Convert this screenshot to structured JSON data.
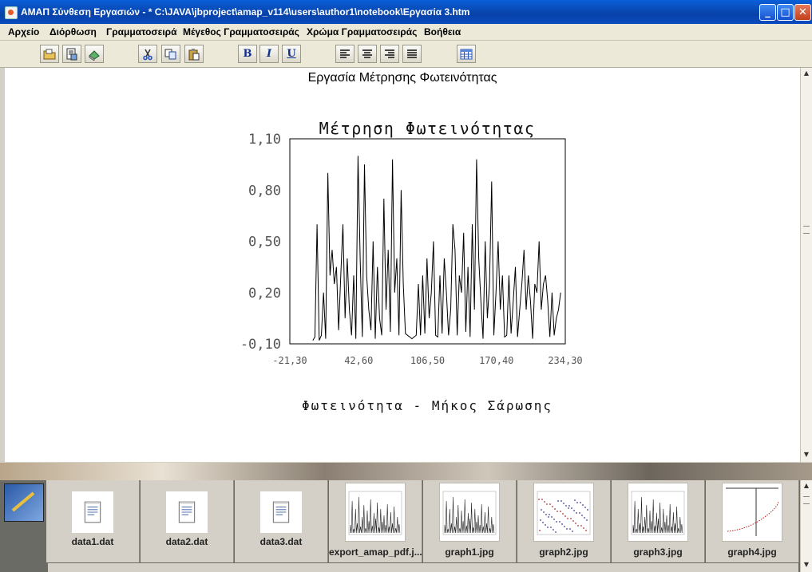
{
  "window": {
    "title": "ΑΜΑΠ Σύνθεση Εργασιών - * C:\\JAVA\\jbproject\\amap_v114\\users\\author1\\notebook\\Εργασία 3.htm",
    "minimize": "_",
    "maximize": "□",
    "close": "✕"
  },
  "menu": {
    "items": [
      "Αρχείο",
      "Διόρθωση",
      "Γραμματοσειρά",
      "Μέγεθος Γραμματοσειράς",
      "Χρώμα Γραμματοσειράς",
      "Βοήθεια"
    ]
  },
  "toolbar": {
    "bold": "B",
    "italic": "I",
    "underline": "U"
  },
  "document": {
    "heading": "Εργασία Μέτρησης Φωτεινότητας"
  },
  "chart_data": {
    "type": "line",
    "title": "Μέτρηση Φωτεινότητας",
    "xlabel": "Φωτεινότητα - Μήκος Σάρωσης",
    "ylabel": "",
    "xlim": [
      -21.3,
      234.3
    ],
    "ylim": [
      -0.1,
      1.1
    ],
    "x_ticks": [
      "-21,30",
      "42,60",
      "106,50",
      "170,40",
      "234,30"
    ],
    "y_ticks": [
      "-0,10",
      "0,20",
      "0,50",
      "0,80",
      "1,10"
    ],
    "grid": false,
    "legend": "none",
    "line_color": "#000000",
    "x": [
      0,
      2,
      4,
      6,
      8,
      10,
      12,
      14,
      16,
      18,
      20,
      22,
      24,
      26,
      28,
      30,
      32,
      34,
      36,
      38,
      40,
      42,
      44,
      46,
      48,
      50,
      52,
      54,
      56,
      58,
      60,
      62,
      64,
      66,
      68,
      70,
      72,
      74,
      76,
      78,
      80,
      82,
      84,
      86,
      88,
      90,
      92,
      94,
      96,
      98,
      100,
      102,
      104,
      106,
      108,
      110,
      112,
      114,
      116,
      118,
      120,
      122,
      124,
      126,
      128,
      130,
      132,
      134,
      136,
      138,
      140,
      142,
      144,
      146,
      148,
      150,
      152,
      154,
      156,
      158,
      160,
      162,
      164,
      166,
      168,
      170,
      172,
      174,
      176,
      178,
      180,
      182,
      184,
      186,
      188,
      190,
      192,
      194,
      196,
      198,
      200,
      202,
      204,
      206,
      208,
      210,
      212,
      214,
      216,
      218,
      220,
      222,
      224,
      226,
      228,
      230
    ],
    "values": [
      -0.08,
      -0.06,
      0.6,
      -0.08,
      -0.05,
      0.2,
      -0.07,
      0.9,
      0.3,
      0.45,
      0.25,
      0.35,
      -0.02,
      0.3,
      0.6,
      0.05,
      0.4,
      0.1,
      -0.05,
      0.3,
      -0.07,
      1.0,
      0.4,
      -0.06,
      0.95,
      0.3,
      0.1,
      -0.02,
      0.5,
      -0.07,
      0.35,
      0.05,
      -0.05,
      0.75,
      0.1,
      0.45,
      -0.03,
      0.98,
      0.2,
      0.4,
      -0.05,
      0.8,
      0.25,
      -0.04,
      -0.05,
      -0.06,
      -0.07,
      -0.06,
      -0.05,
      0.25,
      -0.05,
      0.3,
      -0.04,
      0.4,
      0.05,
      0.2,
      0.5,
      -0.05,
      -0.06,
      0.3,
      -0.04,
      0.4,
      0.2,
      -0.05,
      0.1,
      0.6,
      0.45,
      -0.05,
      0.3,
      0.2,
      0.55,
      -0.03,
      0.35,
      -0.06,
      0.6,
      0.1,
      0.98,
      0.4,
      0.15,
      -0.07,
      0.5,
      0.05,
      0.25,
      0.85,
      -0.05,
      0.2,
      0.5,
      0.1,
      0.3,
      -0.06,
      -0.05,
      0.3,
      -0.04,
      0.15,
      0.35,
      -0.06,
      0.1,
      0.25,
      0.45,
      0.1,
      0.3,
      0.15,
      -0.07,
      0.25,
      0.2,
      0.5,
      0.1,
      0.25,
      0.3,
      0.15,
      -0.06,
      0.2,
      -0.05,
      0.05,
      0.1,
      0.2
    ]
  },
  "thumbnails": [
    {
      "label": "data1.dat",
      "kind": "doc"
    },
    {
      "label": "data2.dat",
      "kind": "doc"
    },
    {
      "label": "data3.dat",
      "kind": "doc"
    },
    {
      "label": "export_amap_pdf.j...",
      "kind": "graph"
    },
    {
      "label": "graph1.jpg",
      "kind": "graph"
    },
    {
      "label": "graph2.jpg",
      "kind": "scatter"
    },
    {
      "label": "graph3.jpg",
      "kind": "graph"
    },
    {
      "label": "graph4.jpg",
      "kind": "curve"
    }
  ],
  "scroll": {
    "up": "▲",
    "down": "▼"
  }
}
